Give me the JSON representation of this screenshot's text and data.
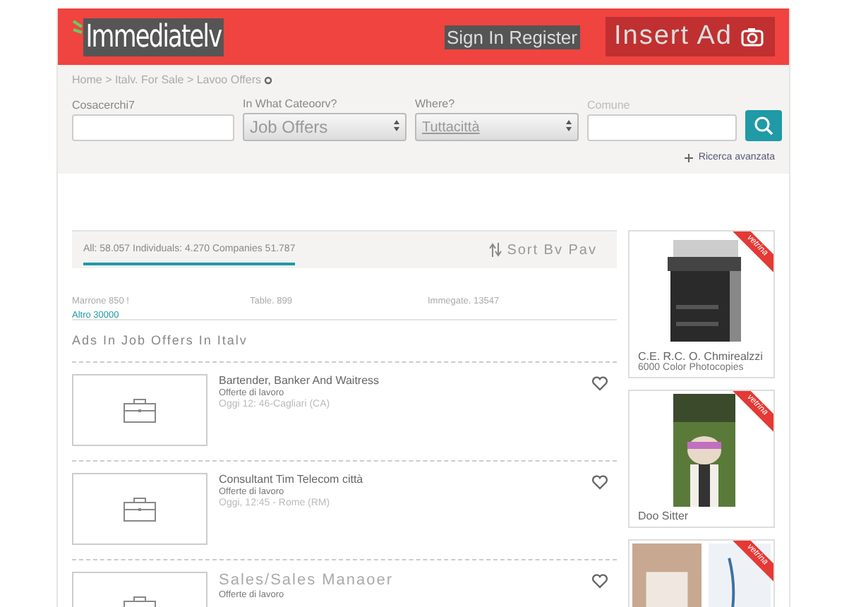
{
  "header": {
    "logo": "Immediatelv",
    "auth_link": "Sign In Register",
    "insert_button": "Insert Ad"
  },
  "breadcrumb": "Home > Italv. For Sale > Lavoo Offers",
  "search": {
    "query_label": "Cosacerchi7",
    "category_label": "In What Cateoorv?",
    "category_value": "Job Offers",
    "where_label": "Where?",
    "where_value": "Tuttacittà",
    "comune_label": "Comune",
    "advanced_link": "Ricerca avanzata"
  },
  "tabs": [
    {
      "label": "All: 58.057 Individuals: 4.270 Companies 51.787",
      "selected": true
    }
  ],
  "sort": "Sort Bv Pav",
  "stats": [
    {
      "label": "Marrone 850 !",
      "link": "Altro 30000"
    },
    {
      "label": "Table. 899"
    },
    {
      "label": "Immegate. 13547"
    }
  ],
  "section_title": "Ads In Job Offers In Italv",
  "ads": [
    {
      "title": "Bartender, Banker And Waitress",
      "category": "Offerte di lavoro",
      "meta": "Oggi 12: 46-Cagliari (CA)",
      "favorite": false
    },
    {
      "title": "Consultant Tim Telecom città",
      "category": "Offerte di lavoro",
      "meta": "Oggi, 12:45 - Rome (RM)",
      "favorite": false
    },
    {
      "title": "Sales/Sales Manaoer",
      "category": "Offerte di lavoro",
      "favorite": false
    }
  ],
  "showcase": [
    {
      "kind": "picture",
      "badge": "vetrina",
      "title": "C.E. R.C. O. Chmirealzzi",
      "subtitle": "6000 Color Photocopies"
    },
    {
      "kind": "picture",
      "badge": "vetrina",
      "title": "Doo Sitter"
    },
    {
      "kind": "picture",
      "badge": "vetrina"
    }
  ]
}
